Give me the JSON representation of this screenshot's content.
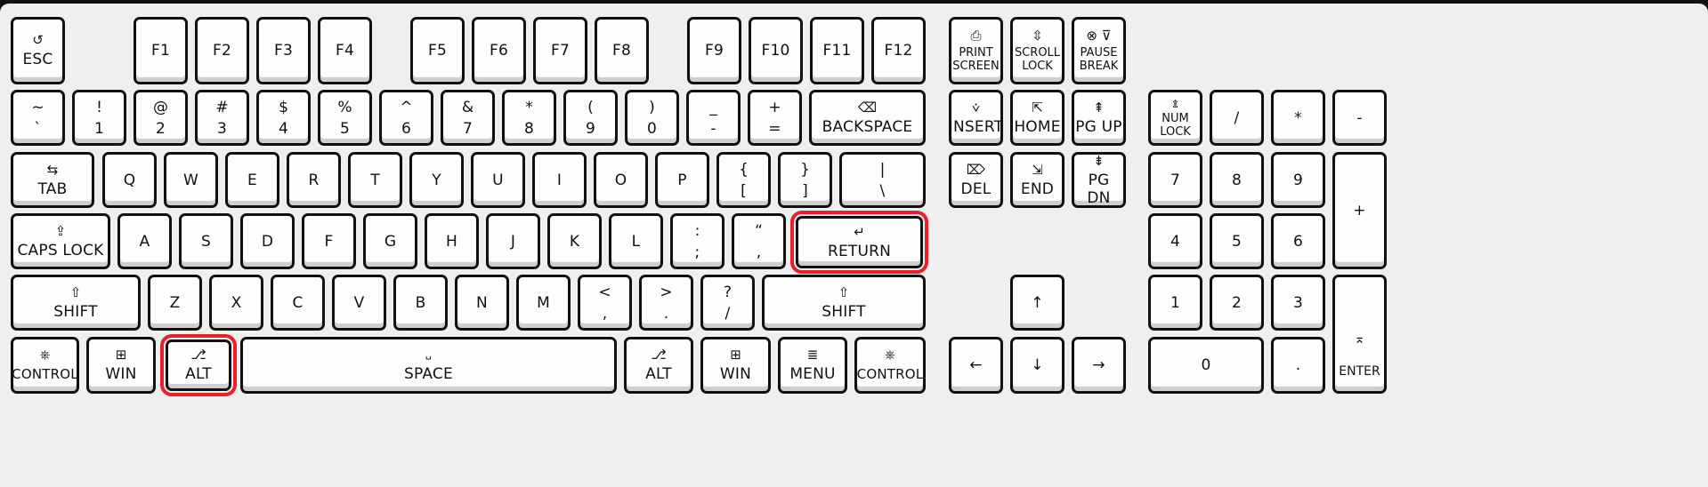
{
  "keyboard": {
    "highlight_color": "#e8202a",
    "function_row": [
      {
        "id": "esc",
        "icon": "↺",
        "label": "ESC"
      },
      {
        "id": "f1",
        "label": "F1"
      },
      {
        "id": "f2",
        "label": "F2"
      },
      {
        "id": "f3",
        "label": "F3"
      },
      {
        "id": "f4",
        "label": "F4"
      },
      {
        "id": "f5",
        "label": "F5"
      },
      {
        "id": "f6",
        "label": "F6"
      },
      {
        "id": "f7",
        "label": "F7"
      },
      {
        "id": "f8",
        "label": "F8"
      },
      {
        "id": "f9",
        "label": "F9"
      },
      {
        "id": "f10",
        "label": "F10"
      },
      {
        "id": "f11",
        "label": "F11"
      },
      {
        "id": "f12",
        "label": "F12"
      },
      {
        "id": "print-screen",
        "icon": "⎙",
        "label1": "PRINT",
        "label2": "SCREEN"
      },
      {
        "id": "scroll-lock",
        "icon": "⇳",
        "label1": "SCROLL",
        "label2": "LOCK"
      },
      {
        "id": "pause-break",
        "icon": "⊗ ⊽",
        "label1": "PAUSE",
        "label2": "BREAK"
      }
    ],
    "number_row": [
      {
        "id": "backtick",
        "top": "~",
        "main": "`"
      },
      {
        "id": "1",
        "top": "!",
        "main": "1"
      },
      {
        "id": "2",
        "top": "@",
        "main": "2"
      },
      {
        "id": "3",
        "top": "#",
        "main": "3"
      },
      {
        "id": "4",
        "top": "$",
        "main": "4"
      },
      {
        "id": "5",
        "top": "%",
        "main": "5"
      },
      {
        "id": "6",
        "top": "^",
        "main": "6"
      },
      {
        "id": "7",
        "top": "&",
        "main": "7"
      },
      {
        "id": "8",
        "top": "*",
        "main": "8"
      },
      {
        "id": "9",
        "top": "(",
        "main": "9"
      },
      {
        "id": "0",
        "top": ")",
        "main": "0"
      },
      {
        "id": "minus",
        "top": "_",
        "main": "-"
      },
      {
        "id": "equals",
        "top": "+",
        "main": "="
      },
      {
        "id": "backspace",
        "icon": "⌫",
        "label": "BACKSPACE"
      }
    ],
    "qwerty_row": [
      {
        "id": "tab",
        "icon": "⇆",
        "label": "TAB"
      },
      {
        "id": "q",
        "label": "Q"
      },
      {
        "id": "w",
        "label": "W"
      },
      {
        "id": "e",
        "label": "E"
      },
      {
        "id": "r",
        "label": "R"
      },
      {
        "id": "t",
        "label": "T"
      },
      {
        "id": "y",
        "label": "Y"
      },
      {
        "id": "u",
        "label": "U"
      },
      {
        "id": "i",
        "label": "I"
      },
      {
        "id": "o",
        "label": "O"
      },
      {
        "id": "p",
        "label": "P"
      },
      {
        "id": "lbracket",
        "top": "{",
        "main": "["
      },
      {
        "id": "rbracket",
        "top": "}",
        "main": "]"
      },
      {
        "id": "backslash",
        "top": "|",
        "main": "\\"
      }
    ],
    "home_row": [
      {
        "id": "caps-lock",
        "icon": "⇪",
        "label": "CAPS LOCK"
      },
      {
        "id": "a",
        "label": "A"
      },
      {
        "id": "s",
        "label": "S"
      },
      {
        "id": "d",
        "label": "D"
      },
      {
        "id": "f",
        "label": "F"
      },
      {
        "id": "g",
        "label": "G"
      },
      {
        "id": "h",
        "label": "H"
      },
      {
        "id": "j",
        "label": "J"
      },
      {
        "id": "k",
        "label": "K"
      },
      {
        "id": "l",
        "label": "L"
      },
      {
        "id": "semicolon",
        "top": ":",
        "main": ";"
      },
      {
        "id": "quote",
        "top": "“",
        "main": ","
      },
      {
        "id": "return",
        "icon": "↵",
        "label": "RETURN",
        "highlighted": true
      }
    ],
    "shift_row": [
      {
        "id": "left-shift",
        "icon": "⇧",
        "label": "SHIFT"
      },
      {
        "id": "z",
        "label": "Z"
      },
      {
        "id": "x",
        "label": "X"
      },
      {
        "id": "c",
        "label": "C"
      },
      {
        "id": "v",
        "label": "V"
      },
      {
        "id": "b",
        "label": "B"
      },
      {
        "id": "n",
        "label": "N"
      },
      {
        "id": "m",
        "label": "M"
      },
      {
        "id": "comma",
        "top": "<",
        "main": ","
      },
      {
        "id": "period",
        "top": ">",
        "main": "."
      },
      {
        "id": "slash",
        "top": "?",
        "main": "/"
      },
      {
        "id": "right-shift",
        "icon": "⇧",
        "label": "SHIFT"
      }
    ],
    "bottom_row": [
      {
        "id": "left-control",
        "icon": "⎈",
        "label": "CONTROL"
      },
      {
        "id": "left-win",
        "icon": "⊞",
        "label": "WIN"
      },
      {
        "id": "left-alt",
        "icon": "⎇",
        "label": "ALT",
        "highlighted": true
      },
      {
        "id": "space",
        "icon": "␣",
        "label": "SPACE"
      },
      {
        "id": "right-alt",
        "icon": "⎇",
        "label": "ALT"
      },
      {
        "id": "right-win",
        "icon": "⊞",
        "label": "WIN"
      },
      {
        "id": "menu",
        "icon": "≣",
        "label": "MENU"
      },
      {
        "id": "right-control",
        "icon": "⎈",
        "label": "CONTROL"
      }
    ],
    "nav_cluster": [
      {
        "id": "insert",
        "icon": "⩒",
        "label": "INSERT"
      },
      {
        "id": "home",
        "icon": "⇱",
        "label": "HOME"
      },
      {
        "id": "page-up",
        "icon": "⇞",
        "label": "PG UP"
      },
      {
        "id": "delete",
        "icon": "⌦",
        "label": "DEL"
      },
      {
        "id": "end",
        "icon": "⇲",
        "label": "END"
      },
      {
        "id": "page-down",
        "icon": "⇟",
        "label": "PG DN"
      }
    ],
    "arrows": [
      {
        "id": "up",
        "label": "↑"
      },
      {
        "id": "left",
        "label": "←"
      },
      {
        "id": "down",
        "label": "↓"
      },
      {
        "id": "right",
        "label": "→"
      }
    ],
    "numpad": [
      {
        "id": "num-lock",
        "icon": "⇭",
        "label1": "NUM",
        "label2": "LOCK"
      },
      {
        "id": "num-divide",
        "label": "/"
      },
      {
        "id": "num-multiply",
        "label": "*"
      },
      {
        "id": "num-minus",
        "label": "-"
      },
      {
        "id": "num-7",
        "label": "7"
      },
      {
        "id": "num-8",
        "label": "8"
      },
      {
        "id": "num-9",
        "label": "9"
      },
      {
        "id": "num-plus",
        "label": "+"
      },
      {
        "id": "num-4",
        "label": "4"
      },
      {
        "id": "num-5",
        "label": "5"
      },
      {
        "id": "num-6",
        "label": "6"
      },
      {
        "id": "num-1",
        "label": "1"
      },
      {
        "id": "num-2",
        "label": "2"
      },
      {
        "id": "num-3",
        "label": "3"
      },
      {
        "id": "num-enter",
        "icon": "⌅",
        "label": "ENTER"
      },
      {
        "id": "num-0",
        "label": "0"
      },
      {
        "id": "num-decimal",
        "label": "."
      }
    ]
  }
}
